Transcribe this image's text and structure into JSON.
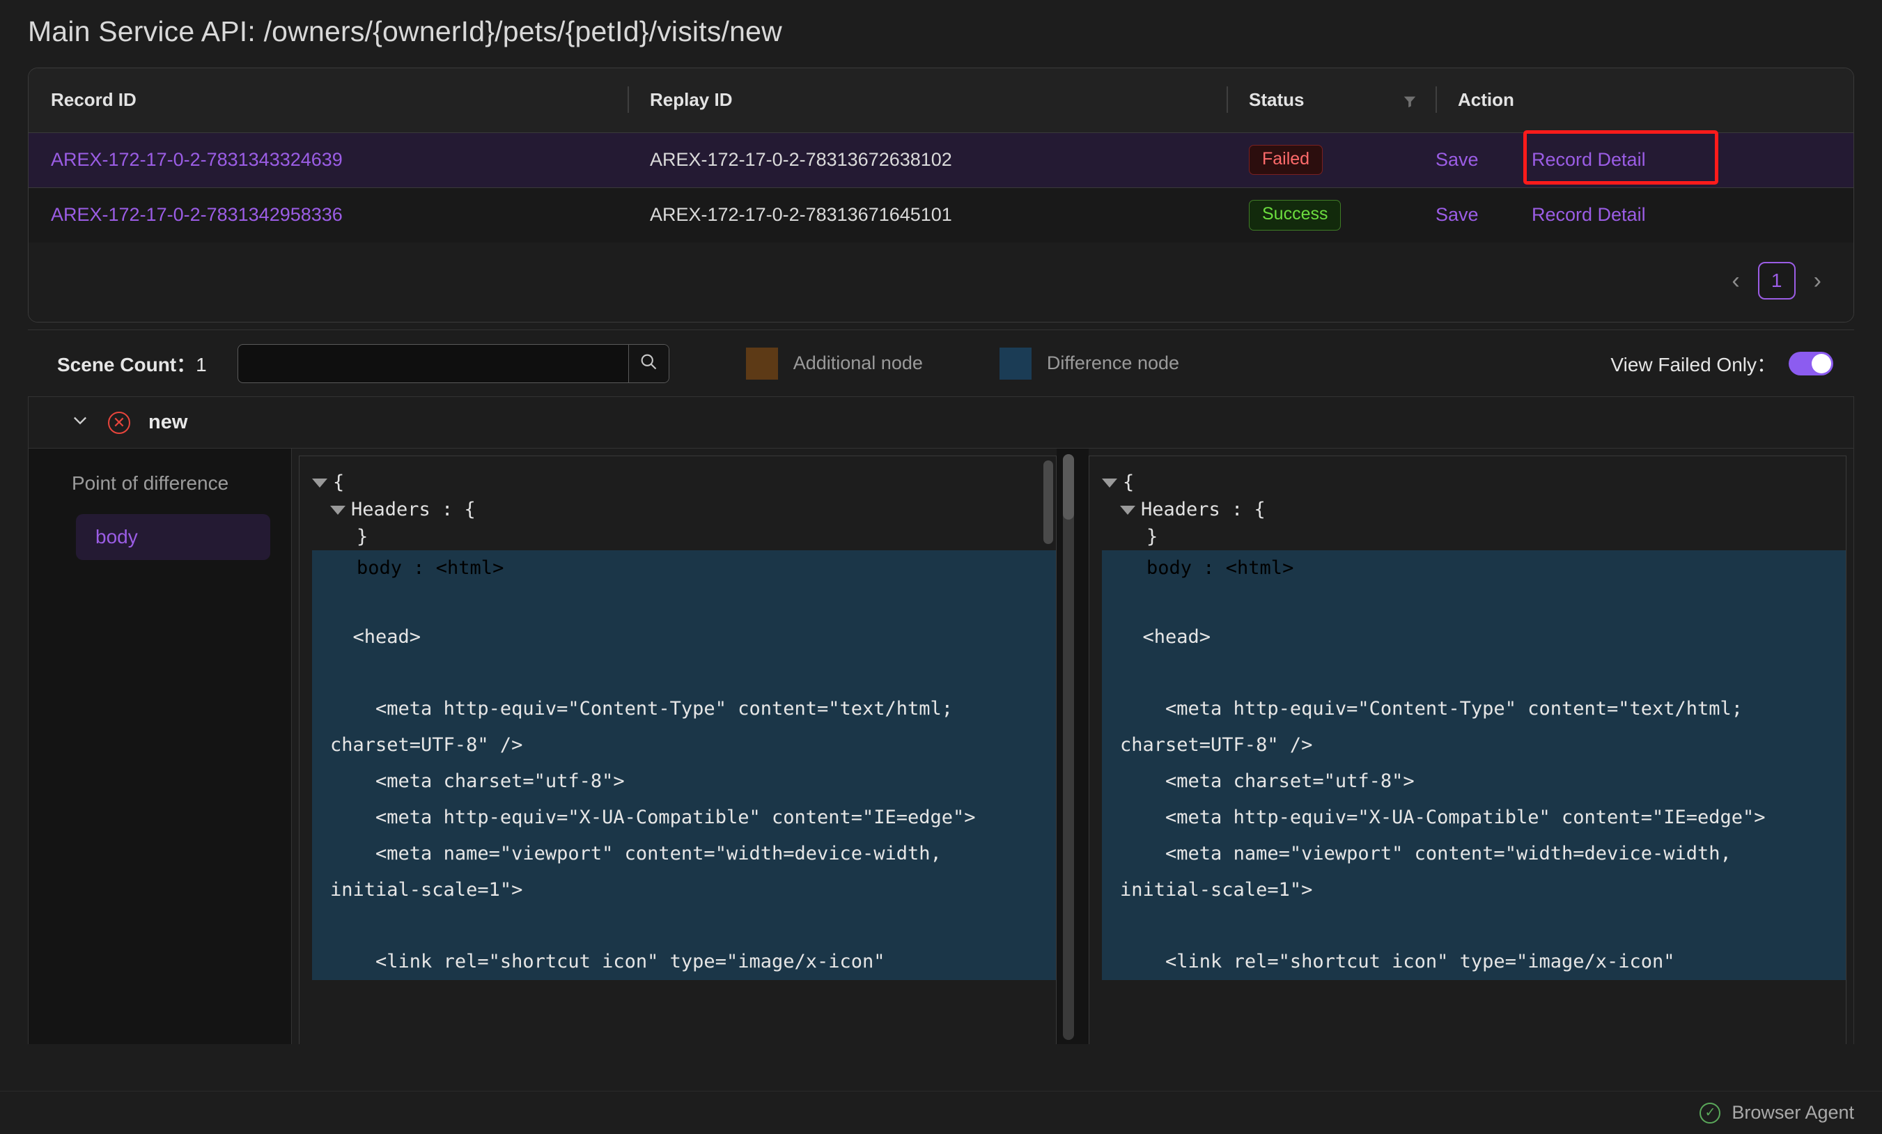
{
  "page_title": "Main Service API: /owners/{ownerId}/pets/{petId}/visits/new",
  "table": {
    "columns": {
      "record_id": "Record ID",
      "replay_id": "Replay ID",
      "status": "Status",
      "action": "Action"
    },
    "rows": [
      {
        "record_id": "AREX-172-17-0-2-7831343324639",
        "replay_id": "AREX-172-17-0-2-78313672638102",
        "status": "Failed",
        "status_kind": "failed",
        "save_label": "Save",
        "detail_label": "Record Detail",
        "highlighted": true
      },
      {
        "record_id": "AREX-172-17-0-2-7831342958336",
        "replay_id": "AREX-172-17-0-2-78313671645101",
        "status": "Success",
        "status_kind": "success",
        "save_label": "Save",
        "detail_label": "Record Detail",
        "highlighted": false
      }
    ]
  },
  "pagination": {
    "prev": "‹",
    "current_page": "1",
    "next": "›"
  },
  "toolbar": {
    "scene_count_label": "Scene Count：",
    "scene_count_value": "1",
    "search_value": "",
    "search_placeholder": "",
    "legend": {
      "additional_label": "Additional node",
      "additional_color": "#5d3a16",
      "difference_label": "Difference node",
      "difference_color": "#1b3c55"
    },
    "view_failed_only_label": "View Failed Only：",
    "view_failed_only_on": true,
    "toggle_color": "#8c5cf0"
  },
  "scene": {
    "name": "new",
    "expanded": true,
    "status": "error"
  },
  "point_of_difference": {
    "title": "Point of difference",
    "items": [
      "body"
    ],
    "selected": "body"
  },
  "diff": {
    "left": {
      "line_open_brace": "{",
      "line_headers": "Headers : {",
      "line_close_brace": "}",
      "line_body": "body : <html>",
      "code": "\n  <head>\n\n    <meta http-equiv=\"Content-Type\" content=\"text/html; charset=UTF-8\" />\n    <meta charset=\"utf-8\">\n    <meta http-equiv=\"X-UA-Compatible\" content=\"IE=edge\">\n    <meta name=\"viewport\" content=\"width=device-width, initial-scale=1\">\n\n    <link rel=\"shortcut icon\" type=\"image/x-icon\""
    },
    "right": {
      "line_open_brace": "{",
      "line_headers": "Headers : {",
      "line_close_brace": "}",
      "line_body": "body : <html>",
      "code": "\n  <head>\n\n    <meta http-equiv=\"Content-Type\" content=\"text/html; charset=UTF-8\" />\n    <meta charset=\"utf-8\">\n    <meta http-equiv=\"X-UA-Compatible\" content=\"IE=edge\">\n    <meta name=\"viewport\" content=\"width=device-width, initial-scale=1\">\n\n    <link rel=\"shortcut icon\" type=\"image/x-icon\""
    }
  },
  "statusbar": {
    "agent_label": "Browser Agent",
    "agent_ok": true
  }
}
